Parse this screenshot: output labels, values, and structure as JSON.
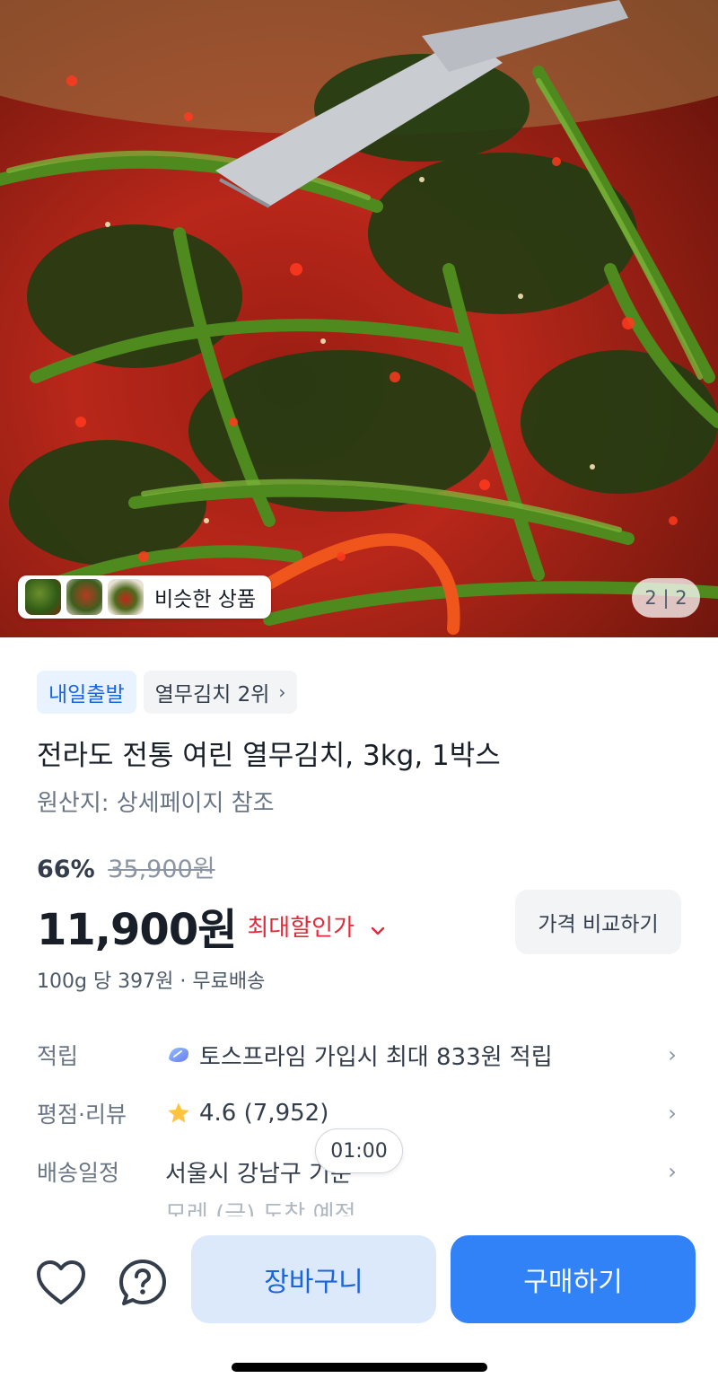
{
  "hero": {
    "similar_label": "비슷한 상품",
    "page_indicator": "2 | 2"
  },
  "badges": {
    "departure": "내일출발",
    "ranking": "열무김치 2위",
    "ranking_chevron": "›"
  },
  "product": {
    "title": "전라도 전통 여린 열무김치, 3kg, 1박스",
    "origin": "원산지: 상세페이지 참조"
  },
  "pricing": {
    "discount_rate": "66%",
    "original_price": "35,900원",
    "price": "11,900원",
    "max_discount_label": "최대할인가",
    "max_discount_chevron": "⌄",
    "compare_button": "가격 비교하기",
    "unit_price": "100g 당 397원 · 무료배송"
  },
  "info_rows": {
    "points": {
      "key": "적립",
      "value": "토스프라임 가입시 최대 833원 적립",
      "icon": "tossprime-icon"
    },
    "review": {
      "key": "평점·리뷰",
      "value": "4.6 (7,952)",
      "icon": "star-icon"
    },
    "delivery": {
      "key": "배송일정",
      "value": "서울시 강남구 기준",
      "sub": "모레 (금) 도착 예정"
    },
    "arrow": "›"
  },
  "timer": "01:00",
  "bottom_bar": {
    "cart_label": "장바구니",
    "buy_label": "구매하기",
    "favorite_icon": "heart-icon",
    "question_icon": "question-bubble-icon"
  },
  "colors": {
    "accent_blue": "#3182f6",
    "cart_bg": "#dbe9fb",
    "discount_red": "#e42939",
    "badge_blue_bg": "#e8f3ff",
    "star": "#ffc342"
  }
}
